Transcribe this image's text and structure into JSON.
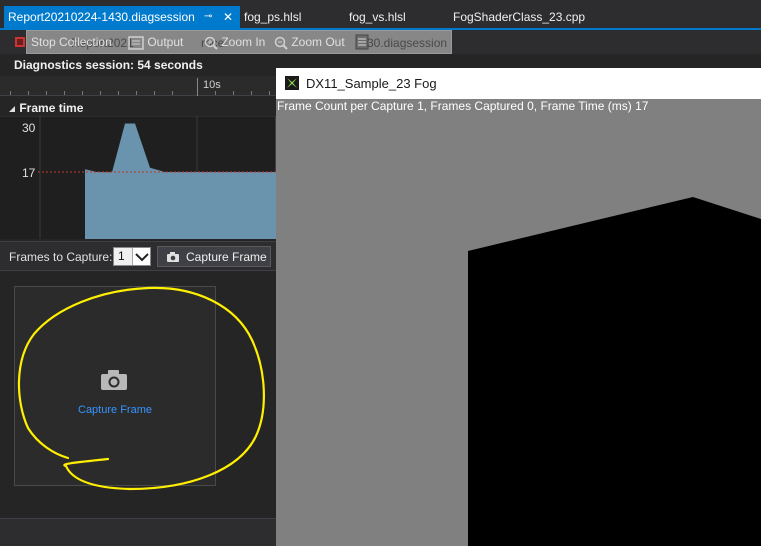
{
  "tabs": [
    {
      "label": "Report20210224-1430.diagsession",
      "pin": "⊸",
      "close": "✕"
    },
    {
      "label": "fog_ps.hlsl"
    },
    {
      "label": "fog_vs.hlsl"
    },
    {
      "label": "FogShaderClass_23.cpp"
    }
  ],
  "toolbar": {
    "stop_label": "Stop Collection",
    "output_label": "Output",
    "zoom_in_label": "Zoom In",
    "zoom_out_label": "Zoom Out",
    "ghost_left": "Report2021",
    "ghost_mid": "roce",
    "ghost_right": "30.diagsession"
  },
  "diagnostics": {
    "session_label": "Diagnostics session: 54 seconds",
    "ruler_tick": "10s",
    "frame_time_header": "Frame time",
    "y_labels": [
      "30",
      "17"
    ]
  },
  "chart_data": {
    "type": "area",
    "title": "Frame time",
    "y_ticks": [
      "30",
      "17"
    ],
    "reference_line": 17,
    "reference_color": "#c0392b",
    "fill_color": "#6a94ad",
    "points": [
      [
        0,
        17.8
      ],
      [
        1,
        17.0
      ],
      [
        2,
        16.9
      ],
      [
        3,
        31.0
      ],
      [
        4,
        31.0
      ],
      [
        5,
        18.2
      ],
      [
        6,
        17.0
      ],
      [
        7,
        17.0
      ],
      [
        8,
        17.0
      ]
    ]
  },
  "capture": {
    "frames_label": "Frames to Capture:",
    "frames_value": "1",
    "button_label": "Capture Frame",
    "thumb_label": "Capture Frame"
  },
  "game": {
    "title": "DX11_Sample_23 Fog",
    "overlay": "Frame Count per Capture 1, Frames Captured 0, Frame Time (ms) 17"
  },
  "colors": {
    "accent": "#007acc",
    "link": "#3794ff",
    "annotation": "#ffef00"
  }
}
